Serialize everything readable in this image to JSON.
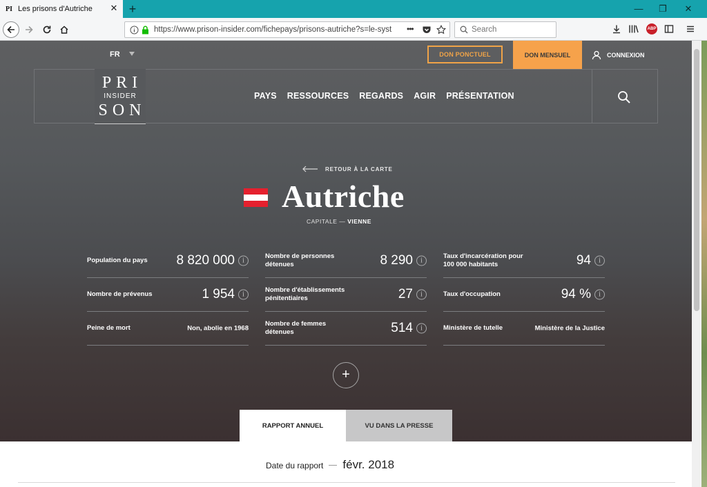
{
  "browser": {
    "tab_title": "Les prisons d'Autriche",
    "favicon_text": "PI",
    "url": "https://www.prison-insider.com/fichepays/prisons-autriche?s=le-syst",
    "search_placeholder": "Search",
    "menu_dots": "•••"
  },
  "header": {
    "lang": "FR",
    "don_ponctuel": "DON PONCTUEL",
    "don_mensuel": "DON MENSUEL",
    "connexion": "CONNEXION",
    "logo": {
      "top": "PRI",
      "middle": "INSIDER",
      "bottom": "SON"
    },
    "nav": [
      "PAYS",
      "RESSOURCES",
      "REGARDS",
      "AGIR",
      "PRÉSENTATION"
    ]
  },
  "hero": {
    "back_label": "RETOUR À LA CARTE",
    "country": "Autriche",
    "capital_label": "CAPITALE",
    "capital_sep": "—",
    "capital_value": "VIENNE",
    "flag_colors": [
      "#e5202e",
      "#ffffff",
      "#e5202e"
    ]
  },
  "stats": [
    {
      "label": "Population du pays",
      "value": "8 820 000",
      "info": true
    },
    {
      "label": "Nombre de personnes détenues",
      "value": "8 290",
      "info": true
    },
    {
      "label": "Taux d'incarcération pour 100 000 habitants",
      "value": "94",
      "info": true
    },
    {
      "label": "Nombre de prévenus",
      "value": "1 954",
      "info": true
    },
    {
      "label": "Nombre d'établissements pénitentiaires",
      "value": "27",
      "info": true
    },
    {
      "label": "Taux d'occupation",
      "value": "94 %",
      "info": true
    },
    {
      "label": "Peine de mort",
      "value": "Non, abolie en 1968",
      "info": false
    },
    {
      "label": "Nombre de femmes détenues",
      "value": "514",
      "info": true
    },
    {
      "label": "Ministère de tutelle",
      "value": "Ministère de la Justice",
      "info": false
    }
  ],
  "info_glyph": "i",
  "more_glyph": "+",
  "tabs": {
    "rapport": "RAPPORT ANNUEL",
    "presse": "VU DANS LA PRESSE"
  },
  "report": {
    "date_label": "Date du rapport",
    "date_value": "févr. 2018"
  },
  "colors": {
    "accent": "#f6a24b",
    "hero_dark": "#3b3031",
    "tab_teal": "#16a3ad"
  }
}
